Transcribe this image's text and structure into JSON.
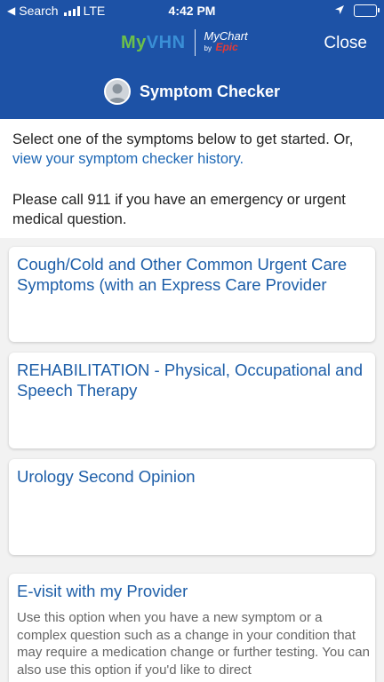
{
  "status_bar": {
    "back_label": "Search",
    "network": "LTE",
    "time": "4:42 PM"
  },
  "header": {
    "logo_text_my": "My",
    "logo_text_vhn": "VHN",
    "mychart_label": "MyChart",
    "by_label": "by",
    "epic_label": "Epic",
    "close_label": "Close",
    "title": "Symptom Checker",
    "background_color": "#1d52a6"
  },
  "intro": {
    "line1_text": "Select one of the symptoms below to get started. Or, ",
    "history_link": "view your symptom checker history.",
    "emergency_text": "Please call 911 if you have an emergency or urgent medical question."
  },
  "cards": [
    {
      "title": "Cough/Cold and Other Common Urgent Care Symptoms (with an Express Care Provider",
      "description": ""
    },
    {
      "title": "REHABILITATION - Physical, Occupational and Speech Therapy",
      "description": ""
    },
    {
      "title": "Urology Second Opinion",
      "description": ""
    },
    {
      "title": "E-visit with my Provider",
      "description": "Use this option when you have a new symptom or a complex question such as a change in your condition that may require a medication change or further testing. You can also use this option if you'd like to direct"
    }
  ]
}
